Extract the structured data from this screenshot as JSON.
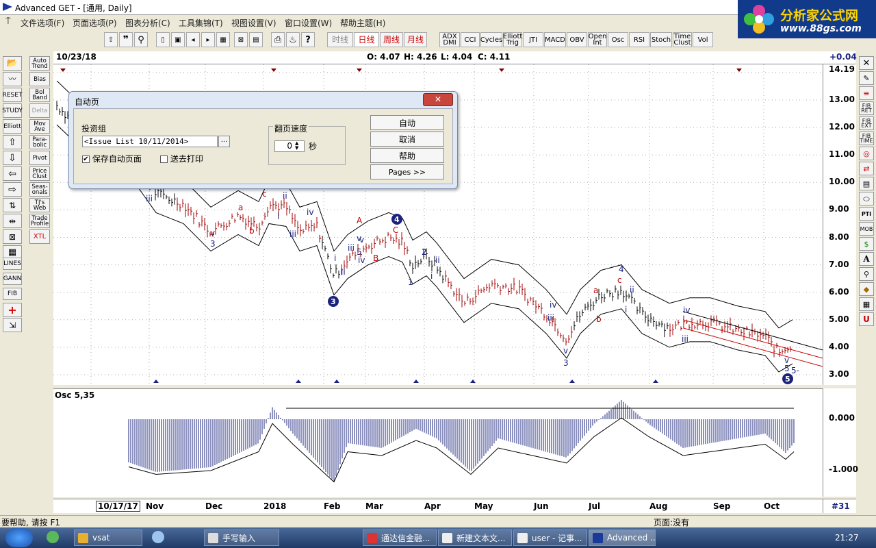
{
  "window": {
    "title": "Advanced GET - [通用, Daily]"
  },
  "logo": {
    "line1": "分析家公式网",
    "line2": "www.88gs.com"
  },
  "menu": [
    "文件选项(F)",
    "页面选项(P)",
    "图表分析(C)",
    "工具集锦(T)",
    "视图设置(V)",
    "窗口设置(W)",
    "帮助主题(H)"
  ],
  "period_tabs": [
    "时线",
    "日线",
    "周线",
    "月线"
  ],
  "indicator_buttons": [
    "ADX DMI",
    "CCI",
    "Cycles",
    "Elliott Trig",
    "JTI",
    "MACD",
    "OBV",
    "Open Int",
    "Osc",
    "RSI",
    "Stoch",
    "Time Clust",
    "Vol"
  ],
  "chart_header": {
    "date": "10/23/18",
    "open": "O: 4.07",
    "high": "H: 4.26",
    "low": "L: 4.04",
    "close": "C: 4.11",
    "change": "+0.04"
  },
  "left_tools": [
    "Auto Trend",
    "Bias",
    "Bol Band",
    "Delta",
    "Mov Ave",
    "Para-bolic",
    "Pivot",
    "Price Clust",
    "Seas-onals",
    "TJ's Web",
    "Trade Profile",
    "XTL"
  ],
  "left_icons": [
    "RESET",
    "STUDY",
    "Elliott",
    "LINES",
    "GANN",
    "FIB"
  ],
  "right_tools": [
    "FIB RET",
    "FIB EXT",
    "FIB TIME",
    "PTI",
    "MOB"
  ],
  "price_axis": [
    "14.19",
    "13.00",
    "12.00",
    "11.00",
    "10.00",
    "9.00",
    "8.00",
    "7.00",
    "6.00",
    "5.00",
    "4.00",
    "3.00"
  ],
  "osc": {
    "label": "Osc 5,35",
    "ticks": [
      "0.000",
      "-1.000"
    ]
  },
  "time_axis": {
    "cursor_date": "10/17/17",
    "labels": [
      "Nov",
      "Dec",
      "2018",
      "Feb",
      "Mar",
      "Apr",
      "May",
      "Jun",
      "Jul",
      "Aug",
      "Sep",
      "Oct"
    ],
    "page": "#31"
  },
  "wave_labels": {
    "blue": [
      "iii",
      "v",
      "3",
      "ii",
      "i",
      "iii",
      "iv",
      "v",
      "5",
      "i",
      "ii",
      "iii",
      "iv",
      "v",
      "2",
      "ii",
      "1",
      "i",
      "iv",
      "iii",
      "v",
      "3",
      "4",
      "ii",
      "i",
      "iv",
      "iii",
      "v",
      "5",
      "5-"
    ],
    "red": [
      "c",
      "a",
      "b",
      "A",
      "B",
      "C",
      "a",
      "b",
      "c"
    ],
    "circled": [
      "4",
      "3",
      "5"
    ]
  },
  "dialog": {
    "title": "自动页",
    "group_label": "投资组",
    "portfolio_value": "<Issue List 10/11/2014>",
    "browse": "...",
    "save_auto_page": "保存自动页面",
    "save_checked": "✔",
    "send_print": "送去打印",
    "speed_label": "翻页速度",
    "speed_value": "0",
    "speed_unit": "秒",
    "buttons": [
      "自动",
      "取消",
      "帮助",
      "Pages >>"
    ]
  },
  "status": {
    "help": "要帮助, 请按 F1",
    "page": "页面:没有"
  },
  "taskbar": {
    "tasks": [
      "vsat",
      "手写输入",
      "通达信金融...",
      "新建文本文...",
      "user - 记事...",
      "Advanced ..."
    ],
    "clock": "21:27"
  },
  "colors": {
    "blue_label": "#1a237e",
    "red_label": "#c00000",
    "bars": "#000000"
  }
}
